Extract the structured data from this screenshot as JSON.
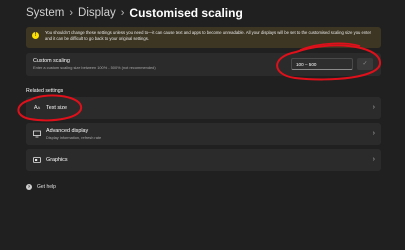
{
  "breadcrumb": {
    "items": [
      "System",
      "Display",
      "Customised scaling"
    ],
    "separator": "›"
  },
  "warning": {
    "icon": "warning-circle-icon",
    "text": "You shouldn't change these settings unless you need to—it can cause text and apps to become unreadable. All your displays will be set to the customised scaling size you enter and it can be difficult to go back to your original settings."
  },
  "custom_scaling": {
    "title": "Custom scaling",
    "description": "Enter a custom scaling size between 100% - 500% (not recommended)",
    "input_value": "100 – 500",
    "confirm_icon": "checkmark-icon"
  },
  "related_settings": {
    "heading": "Related settings",
    "items": [
      {
        "title": "Text size",
        "subtitle": "",
        "icon": "text-size-icon"
      },
      {
        "title": "Advanced display",
        "subtitle": "Display information, refresh rate",
        "icon": "monitor-icon"
      },
      {
        "title": "Graphics",
        "subtitle": "",
        "icon": "graphics-icon"
      }
    ]
  },
  "help": {
    "label": "Get help",
    "icon": "help-icon"
  },
  "colors": {
    "background": "#202020",
    "card": "#2b2b2b",
    "warning_banner": "#3d3623",
    "warning_icon": "#fce100",
    "annotation": "#e0101b"
  }
}
